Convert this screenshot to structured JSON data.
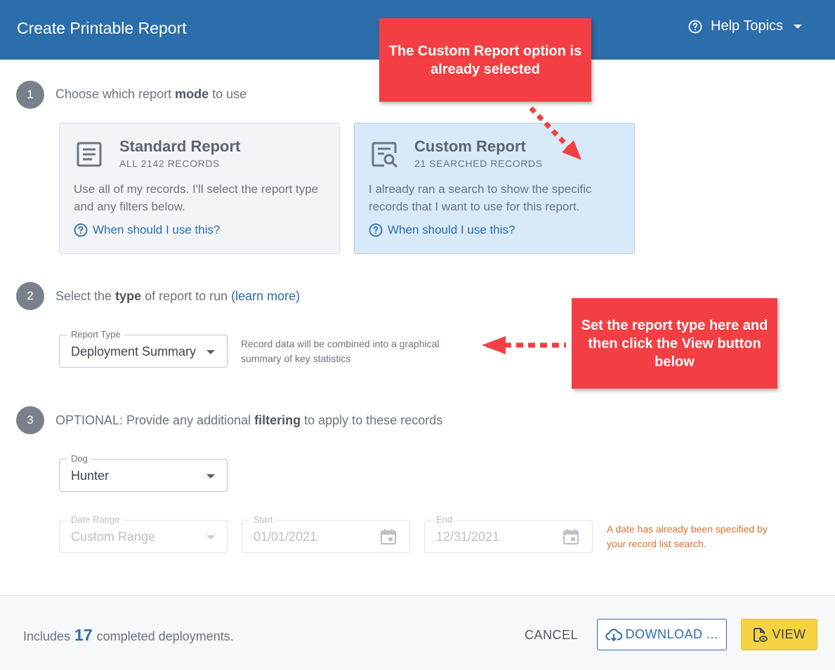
{
  "header": {
    "title": "Create Printable Report",
    "help_label": "Help Topics"
  },
  "steps": [
    {
      "number": "1",
      "pre": "Choose which report ",
      "bold": "mode",
      "post": " to use"
    },
    {
      "number": "2",
      "pre": "Select the ",
      "bold": "type",
      "post": " of report to run ",
      "link": "(learn more)"
    },
    {
      "number": "3",
      "pre": "OPTIONAL: Provide any additional ",
      "bold": "filtering",
      "post": " to apply to these records"
    }
  ],
  "mode_cards": [
    {
      "title": "Standard Report",
      "subtitle": "ALL 2142 RECORDS",
      "description": "Use all of my records. I'll select the report type and any filters below.",
      "help_link": "When should I use this?",
      "icon": "document-list-icon",
      "selected": false
    },
    {
      "title": "Custom Report",
      "subtitle": "21 SEARCHED RECORDS",
      "description": "I already ran a search to show the specific records that I want to use for this report.",
      "help_link": "When should I use this?",
      "icon": "document-search-icon",
      "selected": true
    }
  ],
  "report_type": {
    "label": "Report Type",
    "value": "Deployment Summary",
    "helper": "Record data will be combined into a graphical summary of key statistics"
  },
  "dog": {
    "label": "Dog",
    "value": "Hunter"
  },
  "date_range": {
    "label": "Date Range",
    "value": "Custom Range",
    "start_label": "Start",
    "start_value": "01/01/2021",
    "end_label": "End",
    "end_value": "12/31/2021",
    "warning": "A date has already been specified by your record list search."
  },
  "callouts": {
    "top": "The Custom Report option is already selected",
    "right": "Set the report type here and then click the View button below"
  },
  "footer": {
    "count_prefix": "Includes",
    "count": "17",
    "count_suffix": "completed deployments.",
    "cancel_label": "CANCEL",
    "download_label": "DOWNLOAD ...",
    "view_label": "VIEW"
  },
  "colors": {
    "header_bg": "#2c6dab",
    "accent": "#2c6dab",
    "callout": "#f33f43",
    "view_button": "#f5d242",
    "warning_text": "#e0712c",
    "selected_card": "#d8e9f9"
  }
}
